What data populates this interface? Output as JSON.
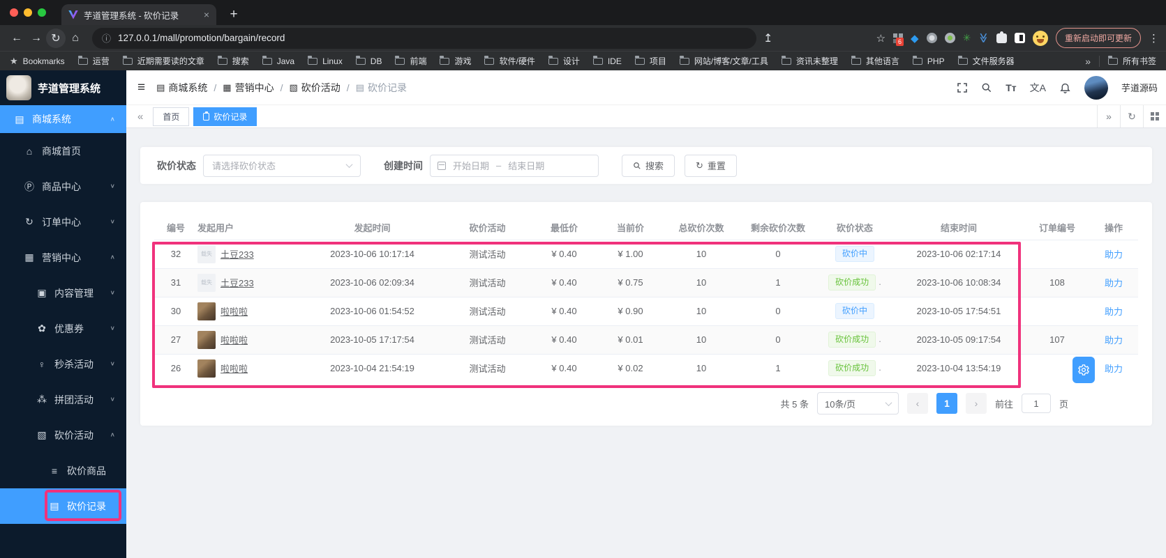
{
  "colors": {
    "accent": "#409eff",
    "annotation": "#f0327c",
    "success": "#67c23a",
    "sidebar_bg": "#0c1b2c"
  },
  "browser": {
    "tab_title": "芋道管理系统 - 砍价记录",
    "tab_close_icon": "×",
    "new_tab_icon": "+",
    "back_icon": "←",
    "forward_icon": "→",
    "reload_icon": "↻",
    "home_icon": "⌂",
    "info_icon": "ⓘ",
    "url": "127.0.0.1/mall/promotion/bargain/record",
    "share_icon": "↥",
    "star_icon": "☆",
    "ext_badge": "6",
    "update_pill": "重新启动即可更新",
    "kebab_icon": "⋮",
    "bookmarks_label": "Bookmarks",
    "bookmarks_star_icon": "★",
    "bookmarks": [
      "运营",
      "近期需要读的文章",
      "搜索",
      "Java",
      "Linux",
      "DB",
      "前端",
      "游戏",
      "软件/硬件",
      "设计",
      "IDE",
      "项目",
      "网站/博客/文章/工具",
      "资讯未整理",
      "其他语言",
      "PHP",
      "文件服务器"
    ],
    "overflow_icon": "»",
    "all_bookmarks": "所有书签"
  },
  "app": {
    "title": "芋道管理系统",
    "hamburger_icon": "≡",
    "breadcrumb": [
      {
        "name": "mall-system",
        "label": "商城系统",
        "glyph": "▤"
      },
      {
        "name": "marketing-center",
        "label": "营销中心",
        "glyph": "▦"
      },
      {
        "name": "bargain-activity",
        "label": "砍价活动",
        "glyph": "▧"
      },
      {
        "name": "bargain-record",
        "label": "砍价记录",
        "glyph": "▤"
      }
    ],
    "font_size_icon": "Tᴛ",
    "locale_icon": "文A",
    "username": "芋道源码"
  },
  "sidebar": {
    "items": [
      {
        "name": "mall-system",
        "icon": "monitor",
        "glyph": "▤",
        "label": "商城系统",
        "level": 0,
        "active": true,
        "arrow": "up"
      },
      {
        "name": "mall-home",
        "icon": "home",
        "glyph": "⌂",
        "label": "商城首页",
        "level": 1,
        "arrow": null
      },
      {
        "name": "product-center",
        "icon": "product",
        "glyph": "Ⓟ",
        "label": "商品中心",
        "level": 1,
        "arrow": "down"
      },
      {
        "name": "order-center",
        "icon": "order",
        "glyph": "↻",
        "label": "订单中心",
        "level": 1,
        "arrow": "down"
      },
      {
        "name": "marketing-center",
        "icon": "bag",
        "glyph": "▦",
        "label": "营销中心",
        "level": 1,
        "arrow": "up"
      },
      {
        "name": "content-management",
        "icon": "book",
        "glyph": "▣",
        "label": "内容管理",
        "level": 2,
        "arrow": "down"
      },
      {
        "name": "coupon",
        "icon": "flower",
        "glyph": "✿",
        "label": "优惠券",
        "level": 2,
        "arrow": "down"
      },
      {
        "name": "seckill-activity",
        "icon": "pin",
        "glyph": "♀",
        "label": "秒杀活动",
        "level": 2,
        "arrow": "down"
      },
      {
        "name": "groupbuy-activity",
        "icon": "group",
        "glyph": "⁂",
        "label": "拼团活动",
        "level": 2,
        "arrow": "down"
      },
      {
        "name": "bargain-activity",
        "icon": "box",
        "glyph": "▧",
        "label": "砍价活动",
        "level": 2,
        "arrow": "up"
      },
      {
        "name": "bargain-product",
        "icon": "stack",
        "glyph": "≡",
        "label": "砍价商品",
        "level": 3,
        "arrow": null
      },
      {
        "name": "bargain-record",
        "icon": "clipboard",
        "glyph": "▤",
        "label": "砍价记录",
        "level": 3,
        "active": true,
        "arrow": null
      }
    ]
  },
  "tags": {
    "back_icon": "«",
    "home_tab": "首页",
    "active_tab": "砍价记录",
    "forward_icon": "»",
    "refresh_icon": "↻"
  },
  "filters": {
    "status_label": "砍价状态",
    "status_placeholder": "请选择砍价状态",
    "time_label": "创建时间",
    "start_placeholder": "开始日期",
    "range_separator": "–",
    "end_placeholder": "结束日期",
    "search_label": "搜索",
    "reset_label": "重置",
    "reset_icon": "↻"
  },
  "table": {
    "headers": [
      "编号",
      "发起用户",
      "发起时间",
      "砍价活动",
      "最低价",
      "当前价",
      "总砍价次数",
      "剩余砍价次数",
      "砍价状态",
      "结束时间",
      "订单编号",
      "操作"
    ],
    "broken_avatar_text": "载失",
    "rows": [
      {
        "id": "32",
        "user": "土豆233",
        "avatar": "broken",
        "start": "2023-10-06 10:17:14",
        "activity": "测试活动",
        "min": "¥ 0.40",
        "cur": "¥ 1.00",
        "total": "10",
        "remain": "0",
        "status": "砍价中",
        "status_type": "ing",
        "suffix": "",
        "end": "2023-10-06 02:17:14",
        "order": "",
        "action": "助力"
      },
      {
        "id": "31",
        "user": "土豆233",
        "avatar": "broken",
        "start": "2023-10-06 02:09:34",
        "activity": "测试活动",
        "min": "¥ 0.40",
        "cur": "¥ 0.75",
        "total": "10",
        "remain": "1",
        "status": "砍价成功",
        "status_type": "success",
        "suffix": ".",
        "end": "2023-10-06 10:08:34",
        "order": "108",
        "action": "助力"
      },
      {
        "id": "30",
        "user": "啦啦啦",
        "avatar": "photo",
        "start": "2023-10-06 01:54:52",
        "activity": "测试活动",
        "min": "¥ 0.40",
        "cur": "¥ 0.90",
        "total": "10",
        "remain": "0",
        "status": "砍价中",
        "status_type": "ing",
        "suffix": "",
        "end": "2023-10-05 17:54:51",
        "order": "",
        "action": "助力"
      },
      {
        "id": "27",
        "user": "啦啦啦",
        "avatar": "photo",
        "start": "2023-10-05 17:17:54",
        "activity": "测试活动",
        "min": "¥ 0.40",
        "cur": "¥ 0.01",
        "total": "10",
        "remain": "0",
        "status": "砍价成功",
        "status_type": "success",
        "suffix": ".",
        "end": "2023-10-05 09:17:54",
        "order": "107",
        "action": "助力"
      },
      {
        "id": "26",
        "user": "啦啦啦",
        "avatar": "photo",
        "start": "2023-10-04 21:54:19",
        "activity": "测试活动",
        "min": "¥ 0.40",
        "cur": "¥ 0.02",
        "total": "10",
        "remain": "1",
        "status": "砍价成功",
        "status_type": "success",
        "suffix": ".",
        "end": "2023-10-04 13:54:19",
        "order": "",
        "action": "助力"
      }
    ]
  },
  "pagination": {
    "total_text": "共 5 条",
    "page_size": "10条/页",
    "prev_icon": "‹",
    "current_page": "1",
    "next_icon": "›",
    "goto_label": "前往",
    "goto_value": "1",
    "page_unit": "页"
  }
}
